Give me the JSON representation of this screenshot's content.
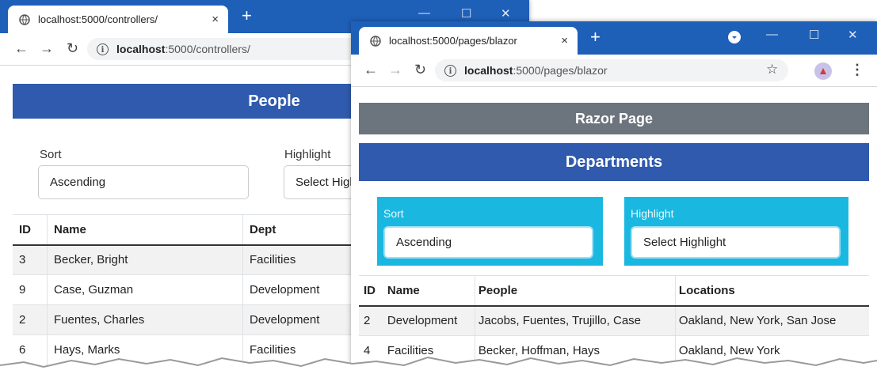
{
  "win1": {
    "tab_title": "localhost:5000/controllers/",
    "tab_close": "×",
    "new_tab": "+",
    "minimize": "—",
    "maximize": "☐",
    "close": "✕",
    "url_host": "localhost",
    "url_path": ":5000/controllers/",
    "banner": "People",
    "sort_label": "Sort",
    "sort_value": "Ascending",
    "highlight_label": "Highlight",
    "highlight_value": "Select Highlight",
    "headers": [
      "ID",
      "Name",
      "Dept"
    ],
    "rows": [
      [
        "3",
        "Becker, Bright",
        "Facilities"
      ],
      [
        "9",
        "Case, Guzman",
        "Development"
      ],
      [
        "2",
        "Fuentes, Charles",
        "Development"
      ],
      [
        "6",
        "Hays, Marks",
        "Facilities"
      ]
    ]
  },
  "win2": {
    "tab_title": "localhost:5000/pages/blazor",
    "tab_close": "×",
    "new_tab": "+",
    "minimize": "—",
    "maximize": "☐",
    "close": "✕",
    "url_host": "localhost",
    "url_path": ":5000/pages/blazor",
    "razor_banner": "Razor Page",
    "banner": "Departments",
    "sort_label": "Sort",
    "sort_value": "Ascending",
    "highlight_label": "Highlight",
    "highlight_value": "Select Highlight",
    "headers": [
      "ID",
      "Name",
      "People",
      "Locations"
    ],
    "rows": [
      [
        "2",
        "Development",
        "Jacobs, Fuentes, Trujillo, Case",
        "Oakland, New York, San Jose"
      ],
      [
        "4",
        "Facilities",
        "Becker, Hoffman, Hays",
        "Oakland, New York"
      ]
    ]
  },
  "colors": {
    "titlebar": "#1e5fb8",
    "banner_blue": "#2f5aad",
    "banner_gray": "#6c757d",
    "cyan": "#1ab8e0"
  },
  "icons": [
    "globe-icon",
    "back-arrow-icon",
    "forward-arrow-icon",
    "reload-icon",
    "info-icon",
    "star-icon",
    "profile-avatar-icon",
    "menu-dots-icon",
    "download-indicator-icon"
  ]
}
